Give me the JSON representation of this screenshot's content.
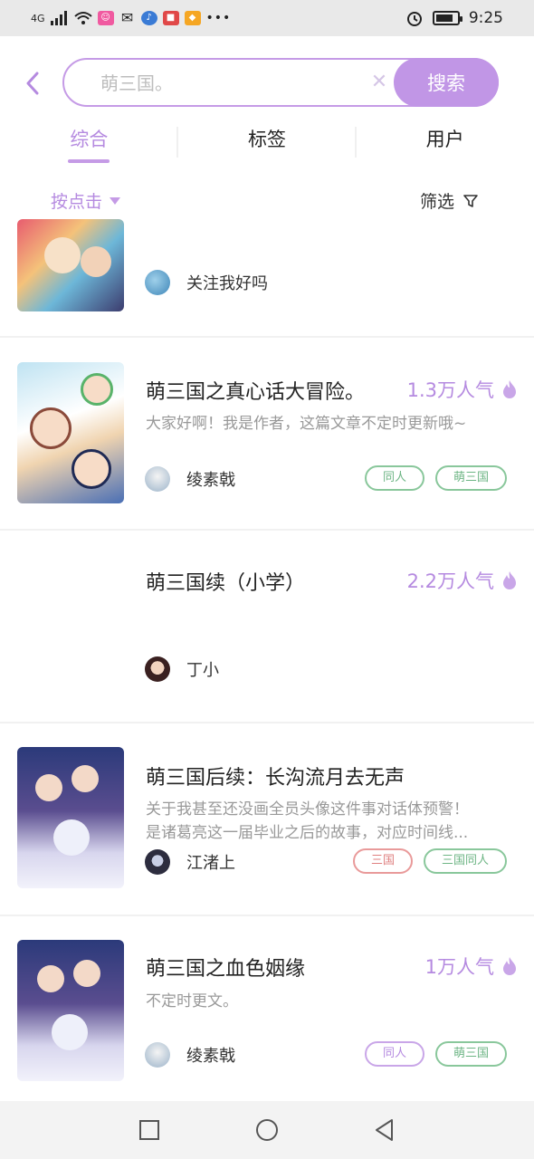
{
  "status_bar": {
    "network": "4G",
    "time": "9:25"
  },
  "search": {
    "placeholder": "萌三国。",
    "button_label": "搜索"
  },
  "tabs": [
    {
      "label": "综合",
      "active": true
    },
    {
      "label": "标签",
      "active": false
    },
    {
      "label": "用户",
      "active": false
    }
  ],
  "filters": {
    "sort_label": "按点击",
    "filter_label": "筛选"
  },
  "items": [
    {
      "author": "关注我好吗"
    },
    {
      "title": "萌三国之真心话大冒险。",
      "popularity": "1.3万人气",
      "description": "大家好啊！我是作者，这篇文章不定时更新哦~",
      "author": "绫素戟",
      "tags": [
        "同人",
        "萌三国"
      ]
    },
    {
      "title": "萌三国续（小学）",
      "popularity": "2.2万人气",
      "author": "丁小"
    },
    {
      "title": "萌三国后续：长沟流月去无声",
      "description_lines": [
        "关于我甚至还没画全员头像这件事对话体预警！",
        "是诸葛亮这一届毕业之后的故事，对应时间线..."
      ],
      "author": "江渚上",
      "tags": [
        "三国",
        "三国同人"
      ]
    },
    {
      "title": "萌三国之血色姻缘",
      "popularity": "1万人气",
      "description": "不定时更文。",
      "author": "绫素戟",
      "tags": [
        "同人",
        "萌三国"
      ]
    }
  ],
  "colors": {
    "accent": "#c196e6",
    "tag_green": "#6db584",
    "tag_red": "#df7f7f"
  }
}
